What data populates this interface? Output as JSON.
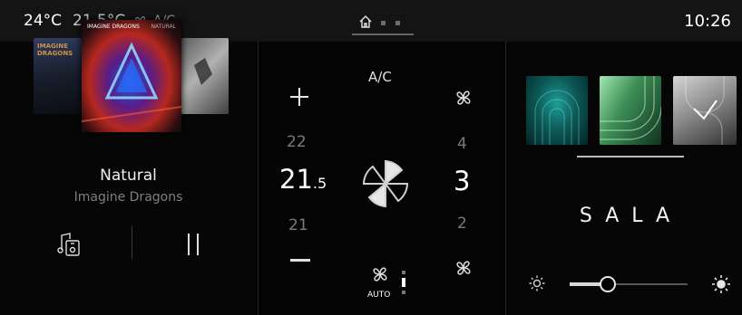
{
  "status": {
    "outside_temp": "24°C",
    "cabin_temp": "21.5°C",
    "ac_label": "A/C",
    "time": "10:26"
  },
  "media": {
    "cover_left_title": "IMAGINE DRAGONS",
    "cover_main_title": "IMAGINE DRAGONS",
    "cover_main_subtitle": "NATURAL",
    "song_title": "Natural",
    "artist": "Imagine Dragons",
    "state": "playing"
  },
  "climate": {
    "ac_label": "A/C",
    "temp_above": "22",
    "temp_current_int": "21",
    "temp_current_dec": ".5",
    "temp_below": "21",
    "fan_above": "4",
    "fan_current": "3",
    "fan_below": "2",
    "auto_label": "AUTO"
  },
  "ambient": {
    "preset_name": "SALA",
    "selected_swatch": "gray",
    "brightness_level": 0.32,
    "colors": {
      "teal": "#1f9d97",
      "green": "#3d8f56",
      "gray": "#8d8d8d"
    }
  },
  "icons": {
    "fan": "fan-icon",
    "home": "home-icon",
    "music_source": "music-source-icon",
    "pause": "pause-icon",
    "sun_low": "brightness-low-icon",
    "sun_high": "brightness-high-icon"
  }
}
